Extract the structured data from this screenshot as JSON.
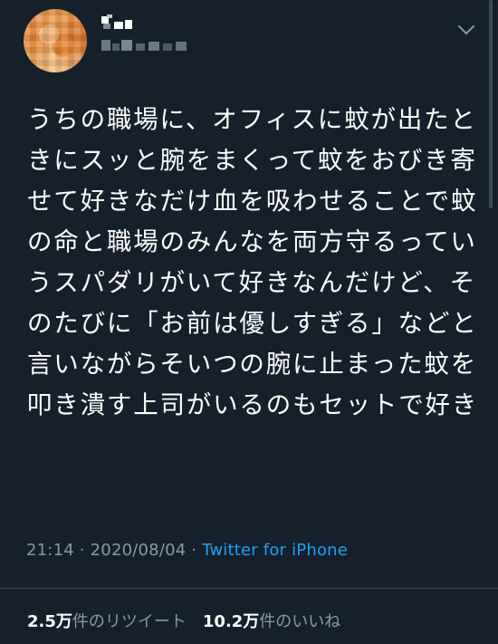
{
  "tweet": {
    "text": "うちの職場に、オフィスに蚊が出たときにスッと腕をまくって蚊をおびき寄せて好きなだけ血を吸わせることで蚊の命と職場のみんなを両方守るっていうスパダリがいて好きなんだけど、そのたびに「お前は優しすぎる」などと言いながらそいつの腕に止まった蚊を叩き潰す上司がいるのもセットで好き",
    "time": "21:14",
    "separator1": " · ",
    "date": "2020/08/04",
    "separator2": " · ",
    "source": "Twitter for iPhone"
  },
  "stats": {
    "retweets_count": "2.5万",
    "retweets_label": "件のリツイート",
    "likes_count": "10.2万",
    "likes_label": "件のいいね"
  },
  "icons": {
    "avatar": "avatar-pixelated",
    "menu": "chevron-down-icon"
  },
  "colors": {
    "background": "#15202b",
    "text_primary": "#ffffff",
    "text_secondary": "#8899a6",
    "link": "#1da1f2",
    "divider": "#38444d"
  }
}
